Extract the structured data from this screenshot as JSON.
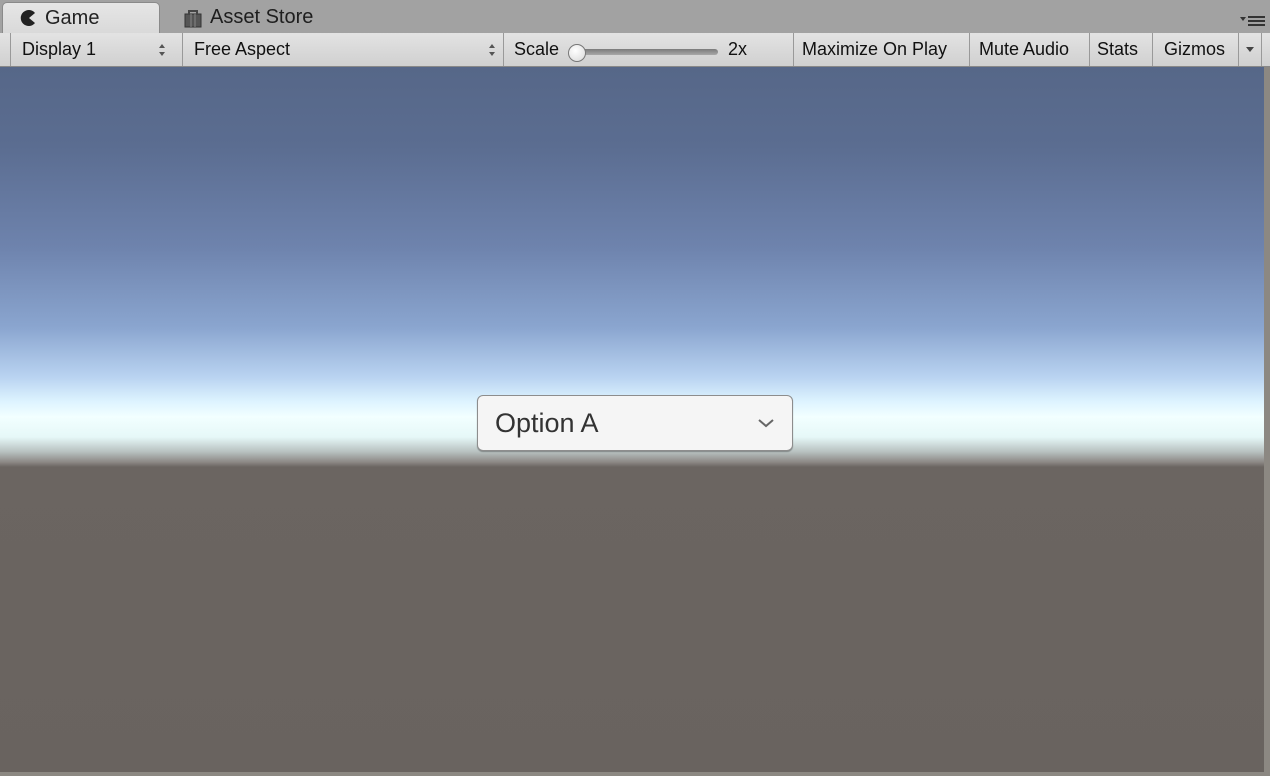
{
  "tabs": [
    {
      "label": "Game",
      "icon": "game-pacman-icon",
      "active": true
    },
    {
      "label": "Asset Store",
      "icon": "asset-store-bag-icon",
      "active": false
    }
  ],
  "toolbar": {
    "display": "Display 1",
    "aspect": "Free Aspect",
    "scale_label": "Scale",
    "scale_value": "2x",
    "scale_slider_fraction": 0.0,
    "maximize": "Maximize On Play",
    "mute": "Mute Audio",
    "stats": "Stats",
    "gizmos": "Gizmos"
  },
  "game_view": {
    "dropdown": {
      "selected": "Option A"
    }
  },
  "colors": {
    "sky_top": "#566788",
    "horizon": "#f2ffff",
    "ground": "#69635f",
    "toolbar": "#dadada",
    "tabbar": "#a2a2a2"
  }
}
